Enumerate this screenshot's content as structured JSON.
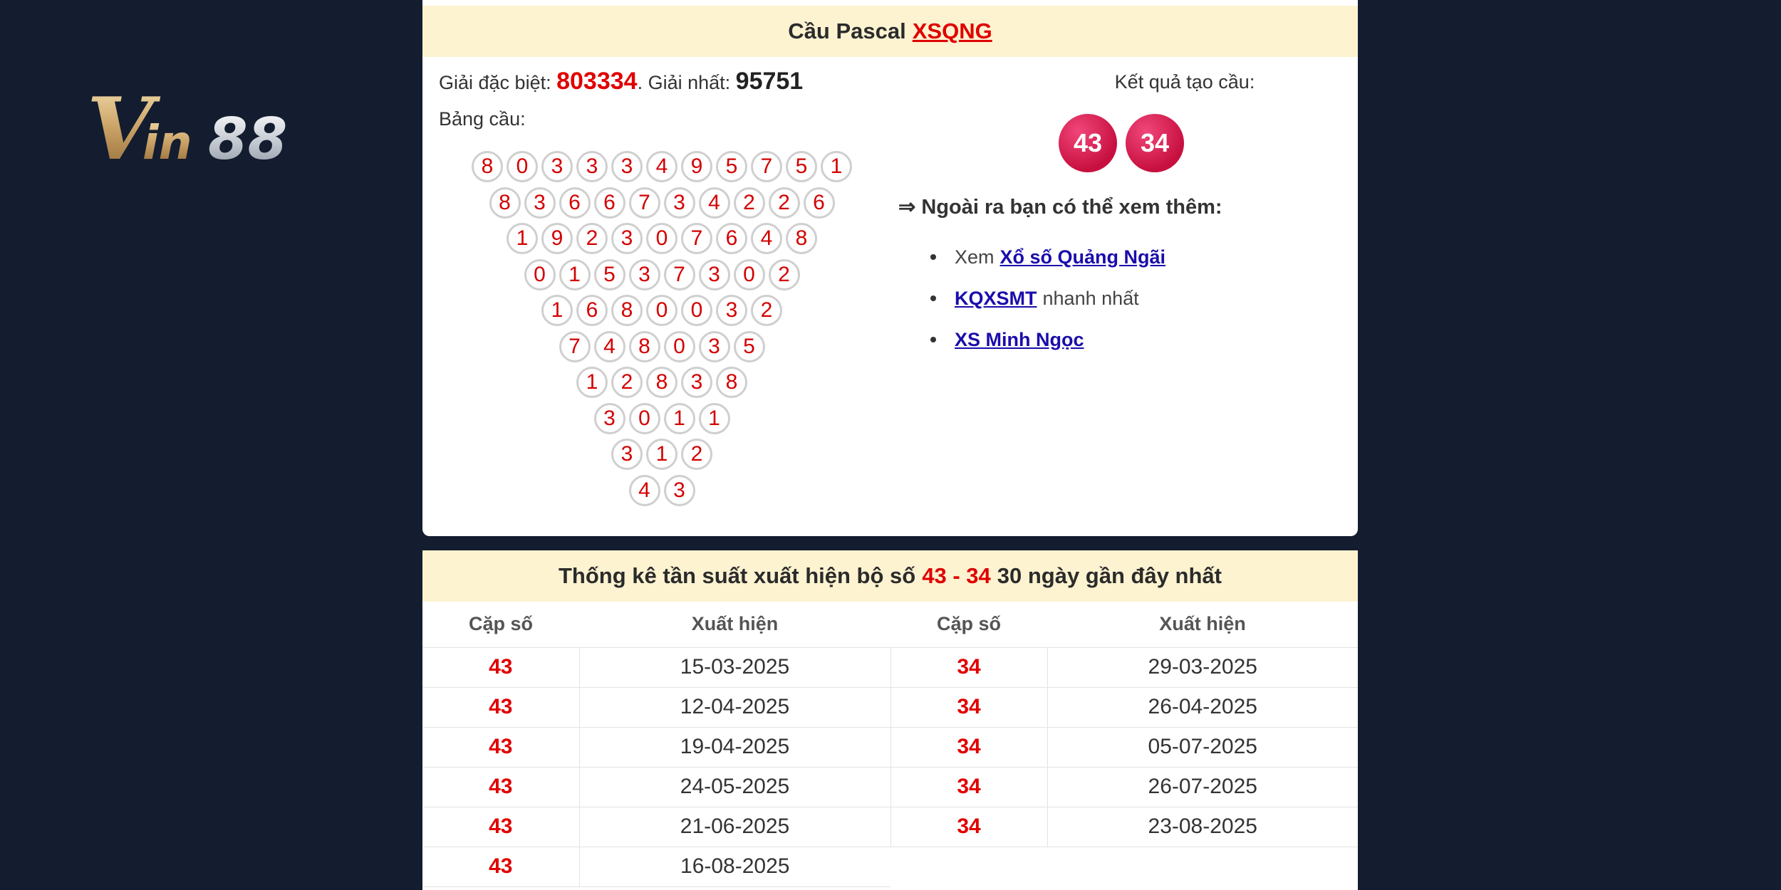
{
  "logo": {
    "text": "Vin88"
  },
  "pascal": {
    "title": "Cầu Pascal",
    "title_link": "XSQNG",
    "special_label": "Giải đặc biệt:",
    "special_value": "803334",
    "first_label": ". Giải nhất:",
    "first_value": "95751",
    "table_label": "Bảng cầu:",
    "rows": [
      [
        "8",
        "0",
        "3",
        "3",
        "3",
        "4",
        "9",
        "5",
        "7",
        "5",
        "1"
      ],
      [
        "8",
        "3",
        "6",
        "6",
        "7",
        "3",
        "4",
        "2",
        "2",
        "6"
      ],
      [
        "1",
        "9",
        "2",
        "3",
        "0",
        "7",
        "6",
        "4",
        "8"
      ],
      [
        "0",
        "1",
        "5",
        "3",
        "7",
        "3",
        "0",
        "2"
      ],
      [
        "1",
        "6",
        "8",
        "0",
        "0",
        "3",
        "2"
      ],
      [
        "7",
        "4",
        "8",
        "0",
        "3",
        "5"
      ],
      [
        "1",
        "2",
        "8",
        "3",
        "8"
      ],
      [
        "3",
        "0",
        "1",
        "1"
      ],
      [
        "3",
        "1",
        "2"
      ],
      [
        "4",
        "3"
      ]
    ],
    "result_label": "Kết quả tạo cầu:",
    "results": [
      "43",
      "34"
    ],
    "more_title": "⇒ Ngoài ra bạn có thể xem thêm:",
    "more": [
      {
        "prefix": "Xem",
        "link": "Xổ số Quảng Ngãi",
        "suffix": ""
      },
      {
        "prefix": "",
        "link": "KQXSMT",
        "suffix": "nhanh nhất"
      },
      {
        "prefix": "",
        "link": "XS Minh Ngọc",
        "suffix": ""
      }
    ]
  },
  "stats": {
    "title_pre": "Thống kê tần suất xuất hiện bộ số",
    "title_pair": "43 - 34",
    "title_post": "30 ngày gần đây nhất",
    "headers": [
      "Cặp số",
      "Xuất hiện",
      "Cặp số",
      "Xuất hiện"
    ],
    "rows": [
      [
        "43",
        "15-03-2025",
        "34",
        "29-03-2025"
      ],
      [
        "43",
        "12-04-2025",
        "34",
        "26-04-2025"
      ],
      [
        "43",
        "19-04-2025",
        "34",
        "05-07-2025"
      ],
      [
        "43",
        "24-05-2025",
        "34",
        "26-07-2025"
      ],
      [
        "43",
        "21-06-2025",
        "34",
        "23-08-2025"
      ],
      [
        "43",
        "16-08-2025",
        "",
        ""
      ]
    ]
  }
}
